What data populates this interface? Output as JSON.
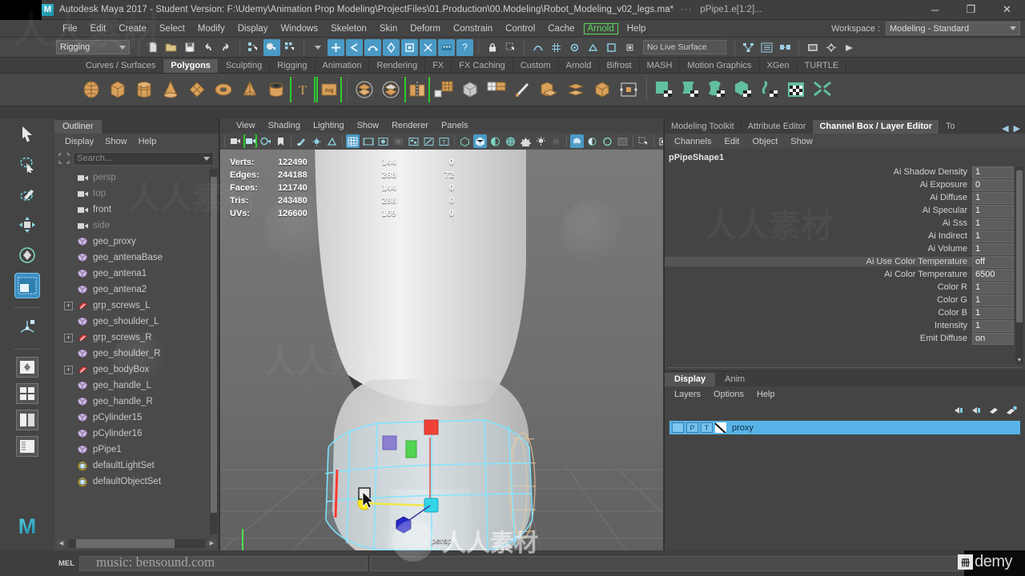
{
  "window": {
    "app_title": "Autodesk Maya 2017 - Student Version: F:\\Udemy\\Animation Prop Modeling\\ProjectFiles\\01.Production\\00.Modeling\\Robot_Modeling_v02_legs.ma*",
    "dots": "···",
    "selection_label": "pPipe1.e[1:2]...",
    "minimize": "─",
    "maximize": "❐",
    "close": "✕"
  },
  "menubar": {
    "items": [
      "File",
      "Edit",
      "Create",
      "Select",
      "Modify",
      "Display",
      "Windows",
      "Skeleton",
      "Skin",
      "Deform",
      "Constrain",
      "Control",
      "Cache"
    ],
    "arnold": "Arnold",
    "help": "Help",
    "workspace_label": "Workspace :",
    "workspace_value": "Modeling - Standard"
  },
  "statusline": {
    "menu_set": "Rigging",
    "live_surface": "No Live Surface"
  },
  "shelf": {
    "tabs": [
      "Curves / Surfaces",
      "Polygons",
      "Sculpting",
      "Rigging",
      "Animation",
      "Rendering",
      "FX",
      "FX Caching",
      "Custom",
      "Arnold",
      "Bifrost",
      "MASH",
      "Motion Graphics",
      "XGen",
      "TURTLE"
    ],
    "active_tab": "Polygons"
  },
  "outliner": {
    "tab": "Outliner",
    "menus": [
      "Display",
      "Show",
      "Help"
    ],
    "search_placeholder": "Search...",
    "items": [
      {
        "label": "persp",
        "icon": "camera-icon",
        "expand": false,
        "dim": true
      },
      {
        "label": "top",
        "icon": "camera-icon",
        "expand": false,
        "dim": true
      },
      {
        "label": "front",
        "icon": "camera-icon",
        "expand": false,
        "dim": false
      },
      {
        "label": "side",
        "icon": "camera-icon",
        "expand": false,
        "dim": true
      },
      {
        "label": "geo_proxy",
        "icon": "mesh-icon",
        "expand": false,
        "dim": false
      },
      {
        "label": "geo_antenaBase",
        "icon": "mesh-icon",
        "expand": false,
        "dim": false
      },
      {
        "label": "geo_antena1",
        "icon": "mesh-icon",
        "expand": false,
        "dim": false
      },
      {
        "label": "geo_antena2",
        "icon": "mesh-icon",
        "expand": false,
        "dim": false
      },
      {
        "label": "grp_screws_L",
        "icon": "group-icon",
        "expand": true,
        "dim": false
      },
      {
        "label": "geo_shoulder_L",
        "icon": "mesh-icon",
        "expand": false,
        "dim": false
      },
      {
        "label": "grp_screws_R",
        "icon": "group-icon",
        "expand": true,
        "dim": false
      },
      {
        "label": "geo_shoulder_R",
        "icon": "mesh-icon",
        "expand": false,
        "dim": false
      },
      {
        "label": "geo_bodyBox",
        "icon": "group-icon",
        "expand": true,
        "dim": false
      },
      {
        "label": "geo_handle_L",
        "icon": "mesh-icon",
        "expand": false,
        "dim": false
      },
      {
        "label": "geo_handle_R",
        "icon": "mesh-icon",
        "expand": false,
        "dim": false
      },
      {
        "label": "pCylinder15",
        "icon": "mesh-icon",
        "expand": false,
        "dim": false
      },
      {
        "label": "pCylinder16",
        "icon": "mesh-icon",
        "expand": false,
        "dim": false
      },
      {
        "label": "pPipe1",
        "icon": "mesh-icon",
        "expand": false,
        "dim": false
      },
      {
        "label": "defaultLightSet",
        "icon": "set-icon",
        "expand": false,
        "dim": false
      },
      {
        "label": "defaultObjectSet",
        "icon": "set-icon",
        "expand": false,
        "dim": false
      }
    ]
  },
  "viewport": {
    "menus": [
      "View",
      "Shading",
      "Lighting",
      "Show",
      "Renderer",
      "Panels"
    ],
    "camera_label": "persp",
    "hud": {
      "rows": [
        {
          "label": "Verts:",
          "total": "122490",
          "c2": "144",
          "c3": "0"
        },
        {
          "label": "Edges:",
          "total": "244188",
          "c2": "288",
          "c3": "72"
        },
        {
          "label": "Faces:",
          "total": "121740",
          "c2": "144",
          "c3": "0"
        },
        {
          "label": "Tris:",
          "total": "243480",
          "c2": "288",
          "c3": "0"
        },
        {
          "label": "UVs:",
          "total": "126600",
          "c2": "169",
          "c3": "0"
        }
      ]
    }
  },
  "right_panel": {
    "tabs": [
      "Modeling Toolkit",
      "Attribute Editor",
      "Channel Box / Layer Editor"
    ],
    "tab_truncated": "To",
    "active_tab": "Channel Box / Layer Editor",
    "arrow_left": "◀",
    "arrow_right": "▶",
    "channelbox": {
      "menus": [
        "Channels",
        "Edit",
        "Object",
        "Show"
      ],
      "node_name": "pPipeShape1",
      "attributes": [
        {
          "label": "Ai Shadow Density",
          "value": "1",
          "highlight": false
        },
        {
          "label": "Ai Exposure",
          "value": "0",
          "highlight": false
        },
        {
          "label": "Ai Diffuse",
          "value": "1",
          "highlight": false
        },
        {
          "label": "Ai Specular",
          "value": "1",
          "highlight": false
        },
        {
          "label": "Ai Sss",
          "value": "1",
          "highlight": false
        },
        {
          "label": "Ai Indirect",
          "value": "1",
          "highlight": false
        },
        {
          "label": "Ai Volume",
          "value": "1",
          "highlight": false
        },
        {
          "label": "Ai Use Color Temperature",
          "value": "off",
          "highlight": true
        },
        {
          "label": "Ai Color Temperature",
          "value": "6500",
          "highlight": false
        },
        {
          "label": "Color R",
          "value": "1",
          "highlight": false
        },
        {
          "label": "Color G",
          "value": "1",
          "highlight": false
        },
        {
          "label": "Color B",
          "value": "1",
          "highlight": false
        },
        {
          "label": "Intensity",
          "value": "1",
          "highlight": false
        },
        {
          "label": "Emit Diffuse",
          "value": "on",
          "highlight": false
        }
      ]
    },
    "layer_editor": {
      "tabs": [
        "Display",
        "Anim"
      ],
      "active_tab": "Display",
      "menus": [
        "Layers",
        "Options",
        "Help"
      ],
      "layers": [
        {
          "visibility": "",
          "playback": "P",
          "template": "T",
          "name": "proxy"
        }
      ]
    }
  },
  "bottom": {
    "mel_label": "MEL",
    "command_text": "music: bensound.com",
    "brand": "demy"
  },
  "watermark": {
    "text": "人人素材",
    "ghost": "人人素材"
  },
  "colors": {
    "accent_blue": "#4a9ac6",
    "shelf_orange": "#d9a05b",
    "uv_green": "#62bfa0",
    "arnold_green": "#5cd65c",
    "layer_selected": "#58b4e8"
  }
}
